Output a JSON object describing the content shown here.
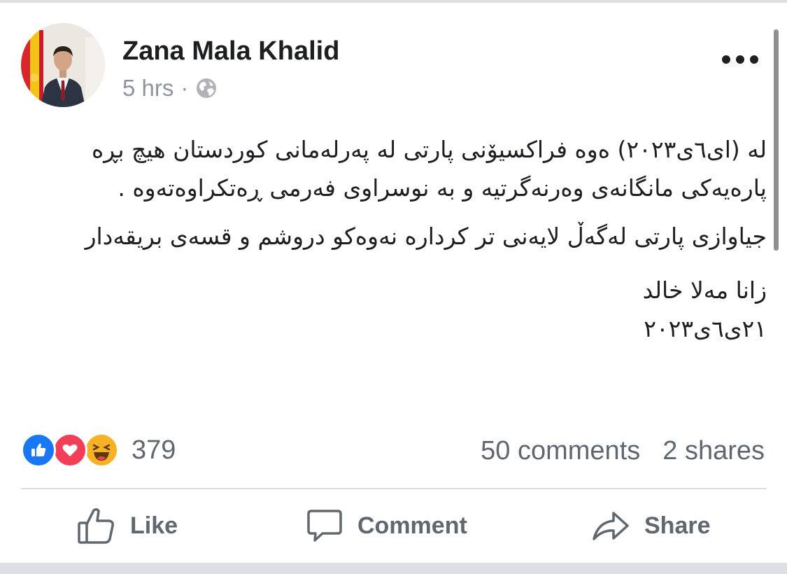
{
  "post": {
    "author": "Zana Mala Khalid",
    "time": "5 hrs",
    "separator": "·",
    "privacy_icon": "globe-icon",
    "more_icon": "more-icon",
    "body_paragraph_1": "له (ای٦ی٢٠٢٣) ەوە فراکسیۆنی پارتی له پەرلەمانی کوردستان هیچ بڕە پارەیەکی مانگانەی وەرنەگرتیه و به نوسراوی فەرمی ڕەتکراوەتەوە .",
    "body_paragraph_2": "جیاوازی پارتی لەگەڵ لایەنی تر کرداره نەوەکو دروشم و قسەی بریقەدار",
    "signature_name": "زانا مەلا خالد",
    "signature_date": "٢١ی٦ی٢٠٢٣"
  },
  "stats": {
    "reaction_icons": [
      "like-icon",
      "love-icon",
      "haha-icon"
    ],
    "reaction_count": "379",
    "comments": "50 comments",
    "shares": "2 shares"
  },
  "actions": {
    "like_label": "Like",
    "comment_label": "Comment",
    "share_label": "Share"
  },
  "colors": {
    "like_blue": "#1877f2",
    "love_red": "#f33e58",
    "haha_yellow": "#f7b125",
    "secondary_text": "#606770",
    "primary_text": "#1c1e21"
  }
}
